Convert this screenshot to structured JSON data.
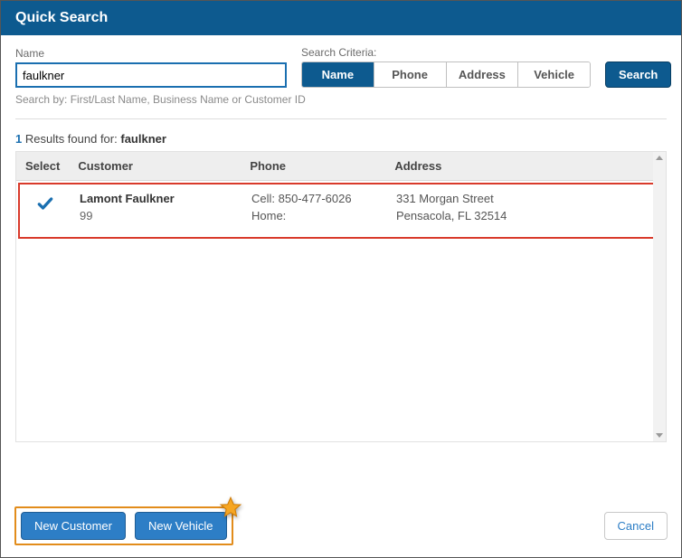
{
  "header": {
    "title": "Quick Search"
  },
  "search": {
    "name_label": "Name",
    "name_value": "faulkner",
    "criteria_label": "Search Criteria:",
    "criteria_options": [
      "Name",
      "Phone",
      "Address",
      "Vehicle"
    ],
    "criteria_active_index": 0,
    "search_button": "Search",
    "hint": "Search by: First/Last Name, Business Name or Customer ID"
  },
  "results": {
    "count": "1",
    "summary_mid": " Results found for: ",
    "term": "faulkner",
    "columns": {
      "select": "Select",
      "customer": "Customer",
      "phone": "Phone",
      "address": "Address"
    },
    "rows": [
      {
        "selected": true,
        "customer_name": "Lamont Faulkner",
        "customer_id": "99",
        "phone_cell": "Cell: 850-477-6026",
        "phone_home": "Home:",
        "address_line1": "331 Morgan Street",
        "address_line2": "Pensacola, FL 32514"
      }
    ]
  },
  "footer": {
    "new_customer": "New Customer",
    "new_vehicle": "New Vehicle",
    "cancel": "Cancel"
  }
}
